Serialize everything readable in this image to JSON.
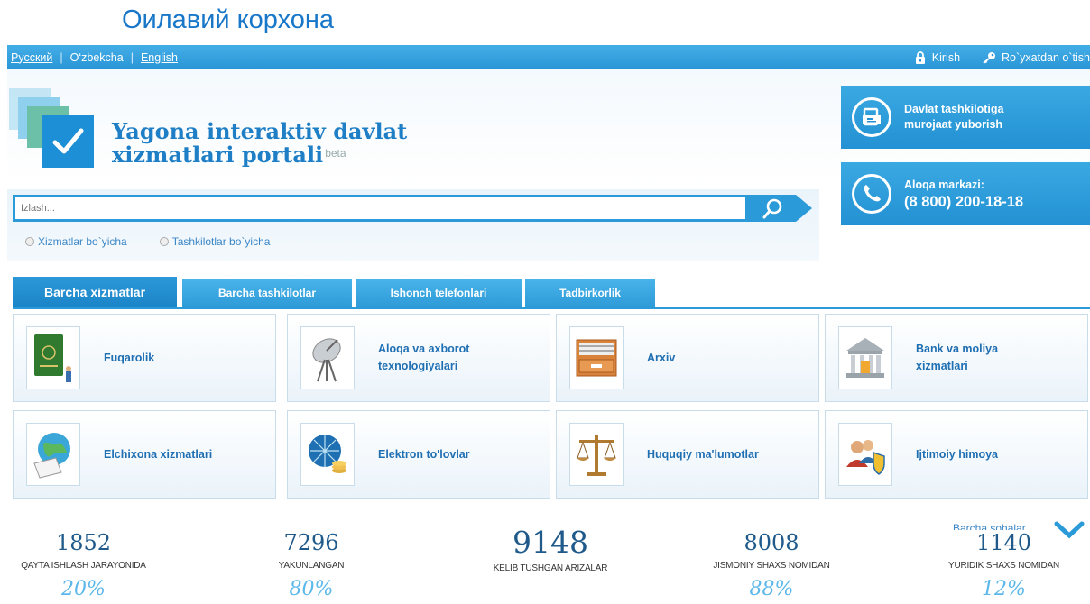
{
  "caption": "Оилавий корхона",
  "topbar": {
    "languages": [
      "Русский",
      "O‘zbekcha",
      "English"
    ],
    "login_label": "Kirish",
    "register_label": "Ro`yxatdan o`tish"
  },
  "header": {
    "title_line1": "Yagona interaktiv davlat",
    "title_line2": "xizmatlari portali",
    "beta": "beta"
  },
  "side_buttons": {
    "appeal_line1": "Davlat tashkilotiga",
    "appeal_line2": "murojaat yuborish",
    "contact_line1": "Aloqa markazi:",
    "contact_phone": "(8 800) 200-18-18"
  },
  "search": {
    "placeholder": "Izlash...",
    "option1": "Xizmatlar bo`yicha",
    "option2": "Tashkilotlar bo`yicha"
  },
  "tabs": [
    "Barcha xizmatlar",
    "Barcha tashkilotlar",
    "Ishonch telefonlari",
    "Tadbirkorlik"
  ],
  "categories": [
    {
      "line1": "Fuqarolik",
      "line2": "",
      "icon": "passport-icon"
    },
    {
      "line1": "Aloqa va axborot",
      "line2": "texnologiyalari",
      "icon": "satellite-dish-icon"
    },
    {
      "line1": "Arxiv",
      "line2": "",
      "icon": "archive-drawer-icon"
    },
    {
      "line1": "Bank va moliya",
      "line2": "xizmatlari",
      "icon": "bank-building-icon"
    },
    {
      "line1": "Elchixona xizmatlari",
      "line2": "",
      "icon": "globe-document-icon"
    },
    {
      "line1": "Elektron to'lovlar",
      "line2": "",
      "icon": "network-globe-coins-icon"
    },
    {
      "line1": "Huquqiy ma'lumotlar",
      "line2": "",
      "icon": "scales-icon"
    },
    {
      "line1": "Ijtimoiy himoya",
      "line2": "",
      "icon": "people-shield-icon"
    }
  ],
  "all_sectors": "Barcha sohalar",
  "stats": [
    {
      "value": "1852",
      "label": "QAYTA ISHLASH JARAYONIDA",
      "percent": "20%"
    },
    {
      "value": "7296",
      "label": "YAKUNLANGAN",
      "percent": "80%"
    },
    {
      "value": "9148",
      "label": "KELIB TUSHGAN ARIZALAR",
      "percent": ""
    },
    {
      "value": "8008",
      "label": "JISMONIY SHAXS NOMIDAN",
      "percent": "88%"
    },
    {
      "value": "1140",
      "label": "YURIDIK SHAXS NOMIDAN",
      "percent": "12%"
    }
  ],
  "colors": {
    "brand_blue": "#2b9ad8",
    "title_blue": "#1f7fc6",
    "percent_blue": "#5cb8ea"
  }
}
